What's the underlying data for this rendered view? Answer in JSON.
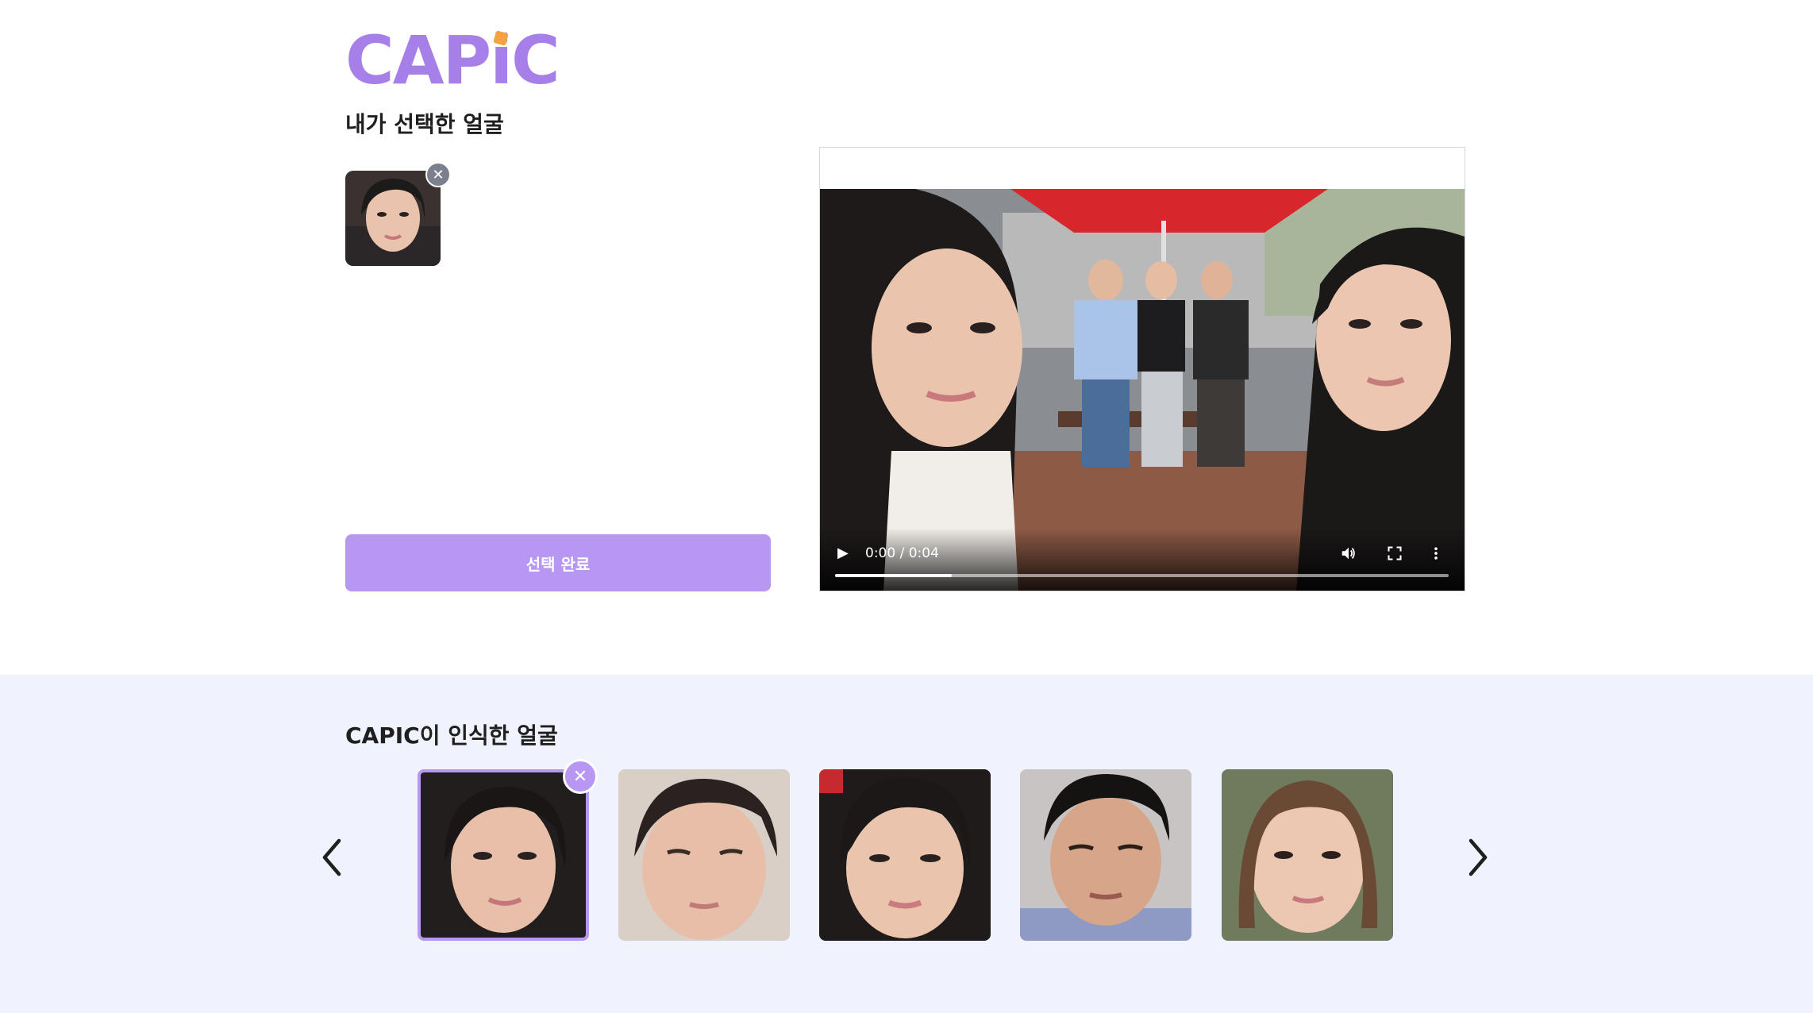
{
  "brand": {
    "logo_text": "CAPiC",
    "accent": "#b897f2",
    "logo_color": "#a77fe9",
    "logo_dot_color": "#f5a243"
  },
  "selected_section": {
    "title": "내가 선택한 얼굴",
    "remove_icon": "close-icon",
    "confirm_label": "선택 완료"
  },
  "video": {
    "time": "0:00 / 0:04",
    "progress_fraction": 0.19,
    "controls": [
      "play-icon",
      "volume-icon",
      "fullscreen-icon",
      "more-vert-icon"
    ]
  },
  "recognized_section": {
    "title": "CAPIC이 인식한 얼굴",
    "prev_icon": "chevron-left-icon",
    "next_icon": "chevron-right-icon",
    "faces": [
      {
        "selected": true
      },
      {
        "selected": false
      },
      {
        "selected": false
      },
      {
        "selected": false
      },
      {
        "selected": false
      }
    ]
  }
}
